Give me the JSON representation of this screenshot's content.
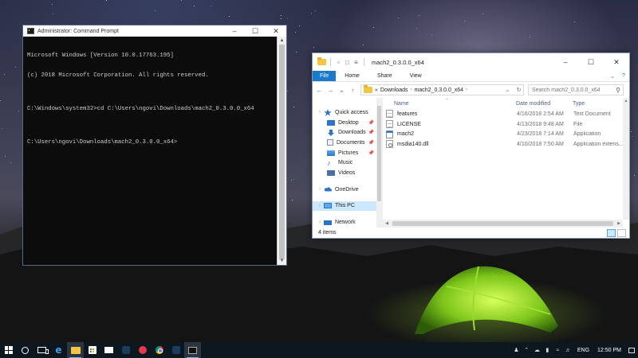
{
  "cmd": {
    "title": "Administrator: Command Prompt",
    "lines": [
      "Microsoft Windows [Version 10.0.17763.195]",
      "(c) 2018 Microsoft Corporation. All rights reserved.",
      "",
      "C:\\Windows\\system32>cd C:\\Users\\ngovi\\Downloads\\mach2_0.3.0.0_x64",
      "",
      "C:\\Users\\ngovi\\Downloads\\mach2_0.3.0.0_x64>"
    ]
  },
  "explorer": {
    "title": "mach2_0.3.0.0_x64",
    "ribbon_tabs": [
      "File",
      "Home",
      "Share",
      "View"
    ],
    "breadcrumb": [
      "«",
      "Downloads",
      "mach2_0.3.0.0_x64"
    ],
    "search_placeholder": "Search mach2_0.3.0.0_x64",
    "nav": [
      {
        "label": "Quick access",
        "icon": "star-icon",
        "level": 0,
        "pinned": false
      },
      {
        "label": "Desktop",
        "icon": "desktop-icon",
        "level": 1,
        "pinned": true
      },
      {
        "label": "Downloads",
        "icon": "downloads-icon",
        "level": 1,
        "pinned": true
      },
      {
        "label": "Documents",
        "icon": "documents-icon",
        "level": 1,
        "pinned": true
      },
      {
        "label": "Pictures",
        "icon": "pictures-icon",
        "level": 1,
        "pinned": true
      },
      {
        "label": "Music",
        "icon": "music-icon",
        "level": 1,
        "pinned": false
      },
      {
        "label": "Videos",
        "icon": "videos-icon",
        "level": 1,
        "pinned": false
      },
      {
        "label": "OneDrive",
        "icon": "onedrive-icon",
        "level": 0,
        "pinned": false
      },
      {
        "label": "This PC",
        "icon": "this-pc-icon",
        "level": 0,
        "pinned": false
      },
      {
        "label": "Network",
        "icon": "network-icon",
        "level": 0,
        "pinned": false
      }
    ],
    "selected_nav": "This PC",
    "columns": {
      "name": "Name",
      "date": "Date modified",
      "type": "Type"
    },
    "files": [
      {
        "name": "features",
        "date": "4/16/2018 2:54 AM",
        "type": "Text Document",
        "icon": "text-file-icon"
      },
      {
        "name": "LICENSE",
        "date": "4/13/2018 9:48 AM",
        "type": "File",
        "icon": "file-icon"
      },
      {
        "name": "mach2",
        "date": "4/23/2018 7:14 AM",
        "type": "Application",
        "icon": "application-icon"
      },
      {
        "name": "msdia140.dll",
        "date": "4/10/2018 7:50 AM",
        "type": "Application extens...",
        "icon": "dll-icon"
      }
    ],
    "status": "4 items"
  },
  "taskbar": {
    "apps": [
      "start-icon",
      "cortana-icon",
      "task-view-icon",
      "edge-icon",
      "file-explorer-icon",
      "store-icon",
      "mail-icon",
      "photoshop-icon",
      "app-icon",
      "chrome-icon",
      "photoshop-icon-2",
      "command-prompt-icon"
    ],
    "language": "ENG",
    "time": "12:50 PM"
  }
}
